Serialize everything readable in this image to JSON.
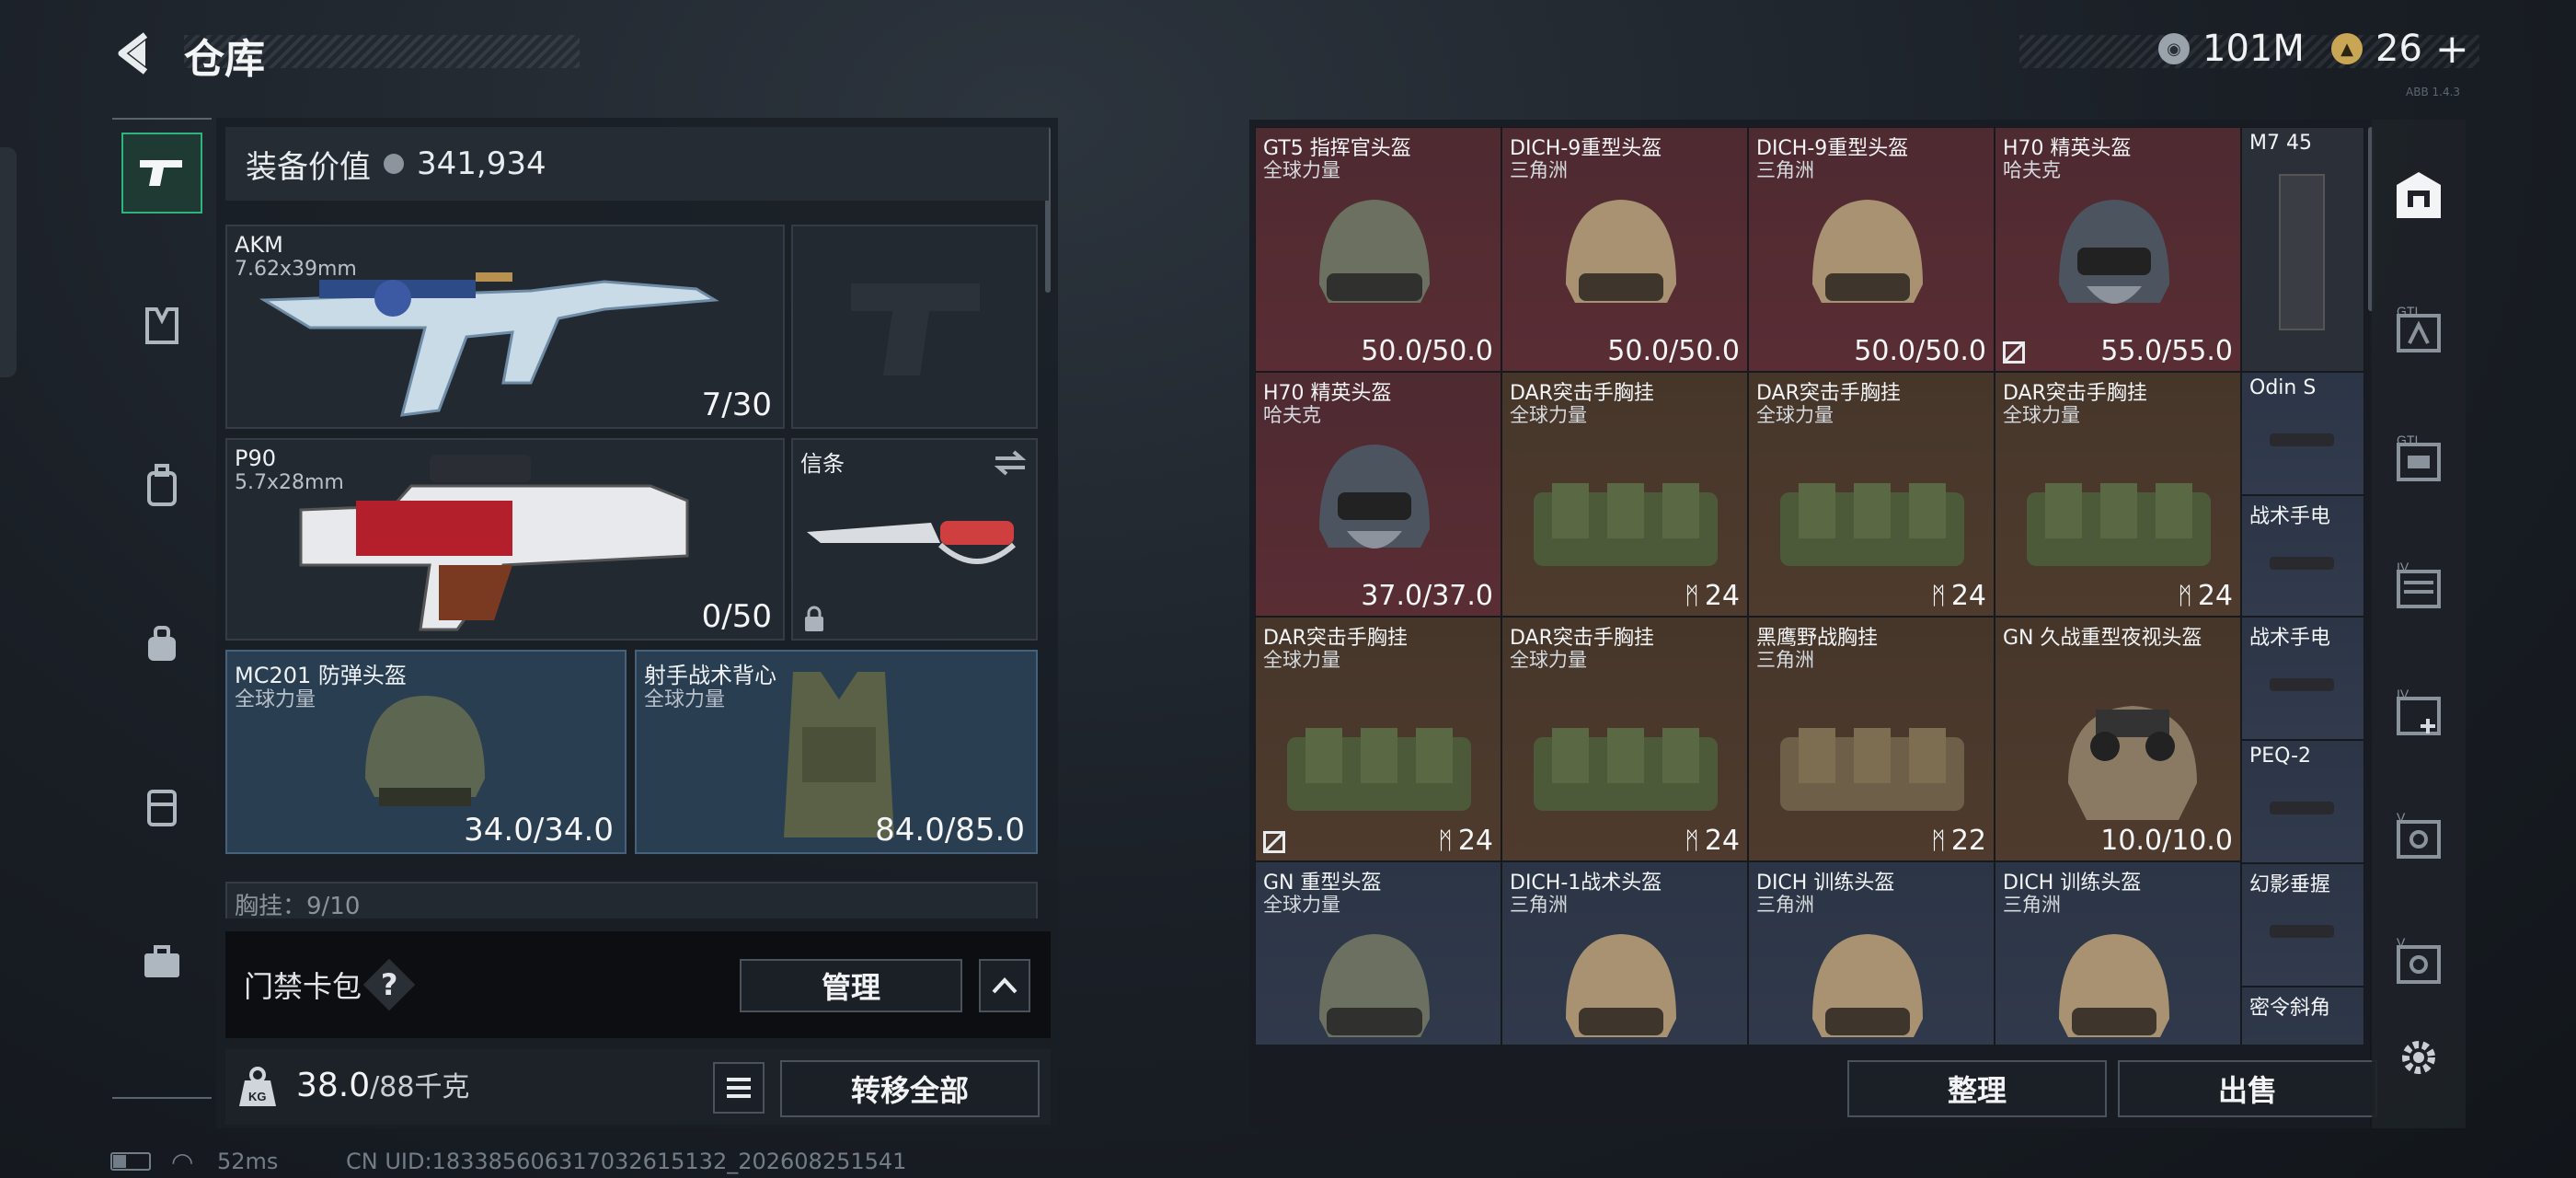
{
  "header": {
    "title": "仓库",
    "currency1": "101M",
    "currency2": "26",
    "plus": "+",
    "uid_small": "ABB 1.4.3"
  },
  "loadout": {
    "value_label": "装备价值",
    "value": "341,934",
    "primary": {
      "name": "AKM",
      "caliber": "7.62x39mm",
      "ammo": "7/30"
    },
    "secondary": {
      "name": "P90",
      "caliber": "5.7x28mm",
      "ammo": "0/50"
    },
    "melee": {
      "name": "信条"
    },
    "helmet": {
      "name": "MC201 防弹头盔",
      "region": "全球力量",
      "durability": "34.0/34.0"
    },
    "armor": {
      "name": "射手战术背心",
      "region": "全球力量",
      "durability": "84.0/85.0"
    },
    "chest_partial": "胸挂：9/10",
    "cardpack_label": "门禁卡包",
    "help": "?",
    "manage": "管理",
    "weight": "38.0",
    "weight_max": "/88千克",
    "transfer_all": "转移全部",
    "kg": "KG"
  },
  "status": {
    "ping": "52ms",
    "uid": "CN UID:18338560631703261513​2_202608251541"
  },
  "stash": {
    "items": [
      {
        "name": "GT5 指挥官头盔",
        "region": "全球力量",
        "value": "50.0/50.0",
        "bg": "red",
        "art": "helmet"
      },
      {
        "name": "DICH-9重型头盔",
        "region": "三角洲",
        "value": "50.0/50.0",
        "bg": "red",
        "art": "helmet-tan"
      },
      {
        "name": "DICH-9重型头盔",
        "region": "三角洲",
        "value": "50.0/50.0",
        "bg": "red",
        "art": "helmet-tan"
      },
      {
        "name": "H70 精英头盔",
        "region": "哈夫克",
        "value": "55.0/55.0",
        "bg": "red",
        "art": "helmet-gray",
        "flag": true
      },
      {
        "name": "H70 精英头盔",
        "region": "哈夫克",
        "value": "37.0/37.0",
        "bg": "red",
        "art": "helmet-gray"
      },
      {
        "name": "DAR突击手胸挂",
        "region": "全球力量",
        "value": "24",
        "bg": "brown",
        "art": "rig",
        "rigicon": true
      },
      {
        "name": "DAR突击手胸挂",
        "region": "全球力量",
        "value": "24",
        "bg": "brown",
        "art": "rig",
        "rigicon": true
      },
      {
        "name": "DAR突击手胸挂",
        "region": "全球力量",
        "value": "24",
        "bg": "brown",
        "art": "rig",
        "rigicon": true
      },
      {
        "name": "DAR突击手胸挂",
        "region": "全球力量",
        "value": "24",
        "bg": "brown",
        "art": "rig",
        "rigicon": true,
        "flag": true
      },
      {
        "name": "DAR突击手胸挂",
        "region": "全球力量",
        "value": "24",
        "bg": "brown",
        "art": "rig",
        "rigicon": true
      },
      {
        "name": "黑鹰野战胸挂",
        "region": "三角洲",
        "value": "22",
        "bg": "brown",
        "art": "rig-tan",
        "rigicon": true
      },
      {
        "name": "GN 久战重型夜视头盔",
        "region": "",
        "value": "10.0/10.0",
        "bg": "brown",
        "art": "nvg"
      },
      {
        "name": "GN 重型头盔",
        "region": "全球力量",
        "value": "",
        "bg": "blue",
        "art": "helmet"
      },
      {
        "name": "DICH-1战术头盔",
        "region": "三角洲",
        "value": "",
        "bg": "blue",
        "art": "helmet-tan"
      },
      {
        "name": "DICH 训练头盔",
        "region": "三角洲",
        "value": "",
        "bg": "blue",
        "art": "helmet-tan"
      },
      {
        "name": "DICH 训练头盔",
        "region": "三角洲",
        "value": "",
        "bg": "blue",
        "art": "helmet-tan"
      }
    ],
    "side_items": [
      "M7 45",
      "Odin S",
      "战术手电",
      "战术手电",
      "PEQ-2",
      "幻影垂握",
      "密令斜角"
    ],
    "sort": "整理",
    "sell": "出售"
  },
  "colors": {
    "accent": "#2fb37f",
    "red_bg": "#552c33",
    "brown_bg": "#4a382b",
    "blue_bg": "#2f3849"
  }
}
